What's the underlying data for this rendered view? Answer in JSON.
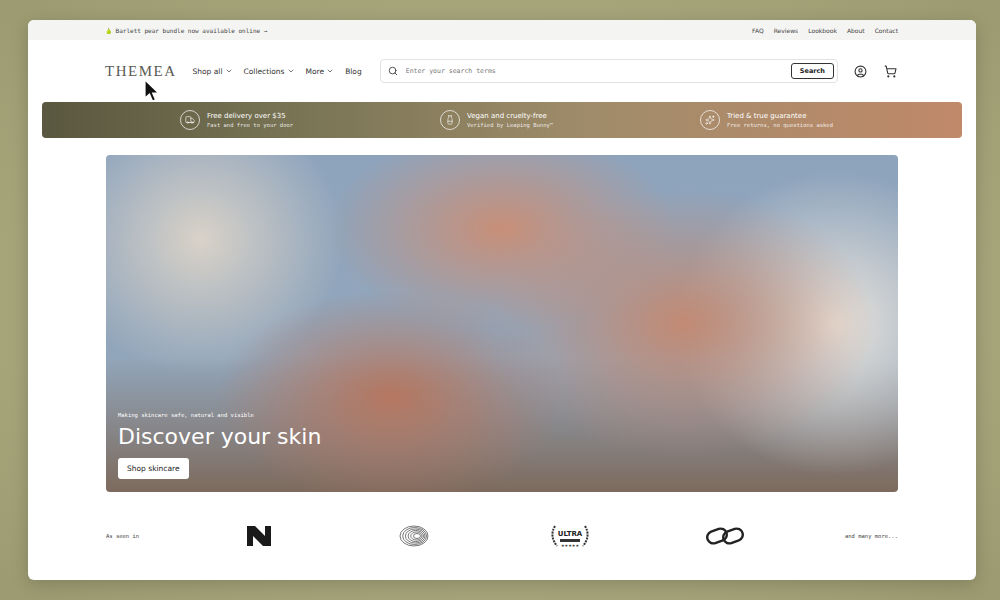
{
  "announcement": {
    "text": "🍐 Barlett pear bundle now available online →"
  },
  "top_links": [
    "FAQ",
    "Reviews",
    "Lookbook",
    "About",
    "Contact"
  ],
  "header": {
    "logo": "THEMEA",
    "nav": [
      {
        "label": "Shop all",
        "has_menu": true
      },
      {
        "label": "Collections",
        "has_menu": true
      },
      {
        "label": "More",
        "has_menu": true
      },
      {
        "label": "Blog",
        "has_menu": false
      }
    ],
    "search": {
      "placeholder": "Enter your search terms",
      "button": "Search"
    }
  },
  "features": [
    {
      "title": "Free delivery over $35",
      "subtitle": "Fast and free to your door"
    },
    {
      "title": "Vegan and cruelty-free",
      "subtitle": "Verified by Leaping Bunny™"
    },
    {
      "title": "Tried & true guarantee",
      "subtitle": "Free returns, no questions asked"
    }
  ],
  "hero": {
    "eyebrow": "Making skincare safe, natural and visible",
    "title": "Discover your skin",
    "button": "Shop skincare"
  },
  "press": {
    "label": "As seen in",
    "logos": [
      {
        "kind": "n"
      },
      {
        "kind": "rings"
      },
      {
        "kind": "badge",
        "text": "ULTRA"
      },
      {
        "kind": "links"
      }
    ],
    "more": "and many more..."
  }
}
